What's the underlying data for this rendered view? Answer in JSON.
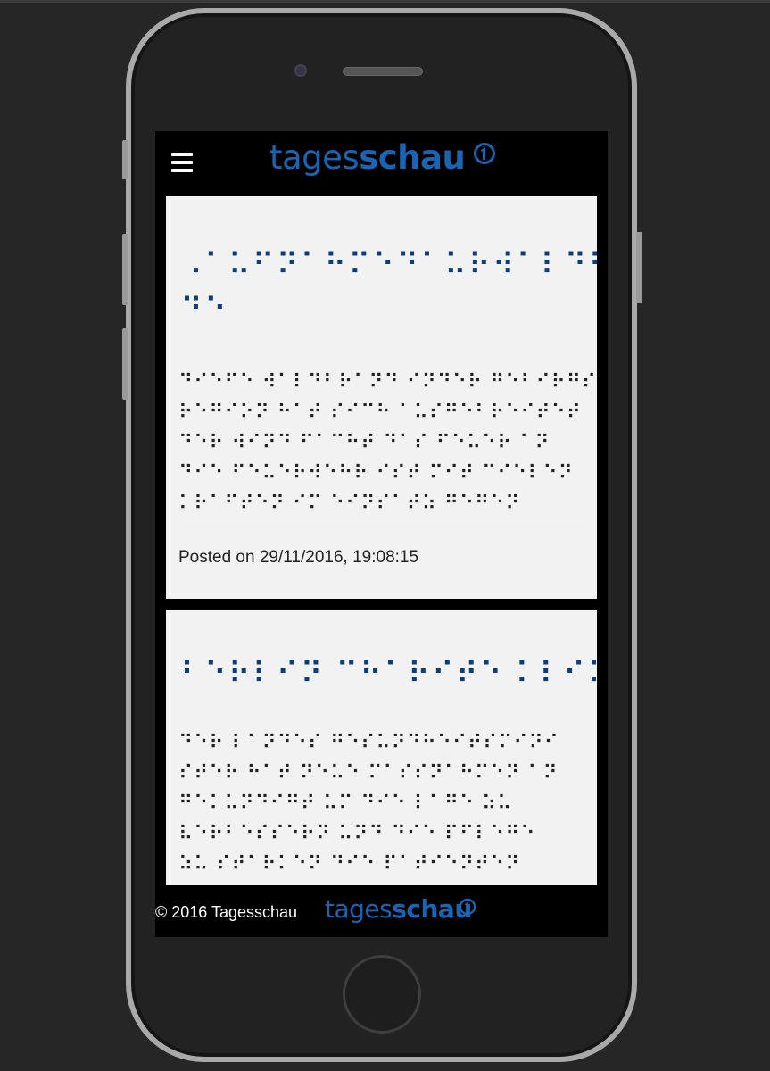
{
  "header": {
    "menu_icon": "hamburger-menu-icon",
    "logo": {
      "light": "tages",
      "bold": "schau",
      "mark_icon": "ard-one-logo-icon"
    }
  },
  "articles": [
    {
      "title_lines": [
        "⠠⠁⠥⠋⠝⠁⠓⠍⠑⠙⠁⠥⠗⠺⠁⠇⠙⠃⠗⠁⠝⠙",
        "⠙⠑"
      ],
      "body_lines": [
        "⠙⠊⠑⠋⠑ ⠺⠁⠇⠙⠃⠗⠁⠝⠙ ⠊⠝⠙⠑⠗ ⠛⠑⠃⠊⠗⠛⠎",
        "⠗⠑⠛⠊⠕⠝ ⠓⠁⠞ ⠎⠊⠉⠓ ⠁⠥⠎⠛⠑⠃⠗⠑⠊⠞⠑⠞",
        "⠙⠑⠗ ⠺⠊⠝⠙ ⠋⠁⠉⠓⠞ ⠙⠁⠎ ⠋⠑⠥⠑⠗ ⠁⠝",
        "⠙⠊⠑ ⠋⠑⠥⠑⠗⠺⠑⠓⠗ ⠊⠎⠞ ⠍⠊⠞ ⠉⠊⠑⠇⠑⠝",
        "⠅⠗⠁⠋⠞⠑⠝ ⠊⠍ ⠑⠊⠝⠎⠁⠞⠵ ⠛⠑⠛⠑⠝"
      ],
      "posted": "Posted on 29/11/2016, 19:08:15"
    },
    {
      "title_lines": [
        "⠃⠑⠗⠇⠊⠝ ⠉⠓⠁⠗⠊⠞⠑ ⠅⠇⠊⠝⠊⠅"
      ],
      "body_lines": [
        "⠙⠑⠗ ⠇⠁⠝⠙⠑⠎ ⠛⠑⠎⠥⠝⠙⠓⠑⠊⠞⠎⠍⠊⠝⠊",
        "⠎⠞⠑⠗ ⠓⠁⠞ ⠝⠑⠥⠑ ⠍⠁⠎⠎⠝⠁⠓⠍⠑⠝ ⠁⠝",
        "⠛⠑⠅⠥⠝⠙⠊⠛⠞ ⠥⠍ ⠙⠊⠑ ⠇⠁⠛⠑ ⠵⠥",
        "⠧⠑⠗⠃⠑⠎⠎⠑⠗⠝ ⠥⠝⠙ ⠙⠊⠑ ⠏⠋⠇⠑⠛⠑",
        "⠵⠥ ⠎⠞⠁⠗⠅⠑⠝ ⠙⠊⠑ ⠏⠁⠞⠊⠑⠝⠞⠑⠝"
      ]
    }
  ],
  "footer": {
    "copyright": "© 2016 Tagesschau",
    "logo": {
      "light": "tages",
      "bold": "schau",
      "mark_icon": "ard-one-logo-icon"
    }
  },
  "colors": {
    "brand_blue": "#1a64b4",
    "braille_blue": "#0b3d7a",
    "card_bg": "#f2f2f2"
  }
}
